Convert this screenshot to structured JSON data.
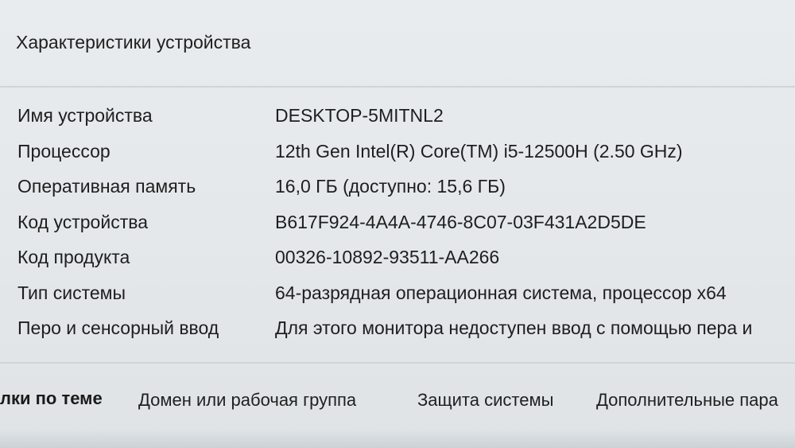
{
  "section": {
    "title": "Характеристики устройства"
  },
  "specs": [
    {
      "label": "Имя устройства",
      "value": "DESKTOP-5MITNL2"
    },
    {
      "label": "Процессор",
      "value": "12th Gen Intel(R) Core(TM) i5-12500H (2.50 GHz)"
    },
    {
      "label": "Оперативная память",
      "value": "16,0 ГБ (доступно: 15,6 ГБ)"
    },
    {
      "label": "Код устройства",
      "value": "B617F924-4A4A-4746-8C07-03F431A2D5DE"
    },
    {
      "label": "Код продукта",
      "value": "00326-10892-93511-AA266"
    },
    {
      "label": "Тип системы",
      "value": "64-разрядная операционная система, процессор x64"
    },
    {
      "label": "Перо и сенсорный ввод",
      "value": "Для этого монитора недоступен ввод с помощью пера и"
    }
  ],
  "related_links": {
    "title": "лки по теме",
    "items": [
      {
        "label": "Домен или рабочая группа"
      },
      {
        "label": "Защита системы"
      },
      {
        "label": "Дополнительные пара"
      }
    ]
  }
}
